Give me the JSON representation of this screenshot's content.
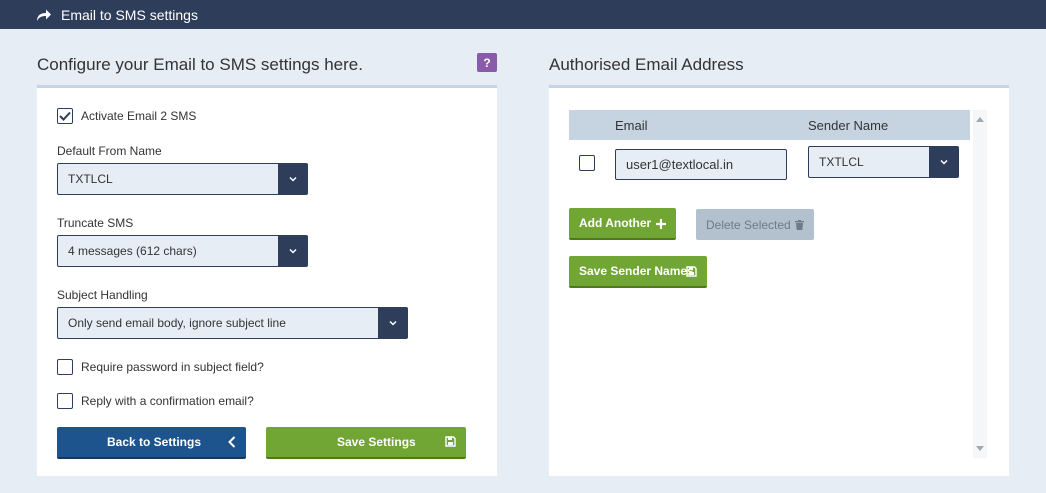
{
  "header": {
    "title": "Email to SMS settings",
    "icon": "share-arrow-icon"
  },
  "left_panel": {
    "heading": "Configure your Email to SMS settings here.",
    "help_label": "?",
    "activate": {
      "label": "Activate Email 2 SMS",
      "checked": true
    },
    "default_from": {
      "label": "Default From Name",
      "value": "TXTLCL"
    },
    "truncate": {
      "label": "Truncate SMS",
      "value": "4 messages (612 chars)"
    },
    "subject": {
      "label": "Subject Handling",
      "value": "Only send email body, ignore subject line"
    },
    "require_password": {
      "label": "Require password in subject field?",
      "checked": false
    },
    "reply_confirm": {
      "label": "Reply with a confirmation email?",
      "checked": false
    },
    "back_button": "Back to Settings",
    "save_button": "Save Settings"
  },
  "right_panel": {
    "heading": "Authorised Email Address",
    "table": {
      "columns": [
        "Email",
        "Sender Name"
      ],
      "rows": [
        {
          "checked": false,
          "email": "user1@textlocal.in",
          "sender": "TXTLCL"
        }
      ]
    },
    "add_button": "Add Another",
    "delete_button": "Delete Selected",
    "save_names_button": "Save Sender Names"
  },
  "colors": {
    "navy": "#2d3d5a",
    "blue": "#1e548e",
    "green": "#71a534",
    "purple": "#8a5ba8",
    "bg": "#e6edf4"
  }
}
